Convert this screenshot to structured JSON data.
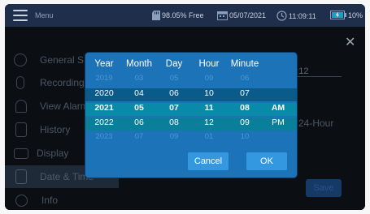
{
  "topbar": {
    "menu_label": "Menu",
    "storage": "98.05% Free",
    "date": "05/07/2021",
    "time": "11:09:11",
    "battery": "10%"
  },
  "sidebar": {
    "items": [
      {
        "label": "General S",
        "icon": "gear-icon"
      },
      {
        "label": "Recording",
        "icon": "microphone-icon"
      },
      {
        "label": "View Alarm",
        "icon": "bell-icon"
      },
      {
        "label": "History",
        "icon": "history-icon"
      },
      {
        "label": "Display",
        "icon": "monitor-icon"
      },
      {
        "label": "Date & Time",
        "icon": "calendar-clock-icon"
      },
      {
        "label": "Info",
        "icon": "info-icon"
      }
    ]
  },
  "background": {
    "time_value": "08:12",
    "format_label": "24-Hour",
    "save_label": "Save"
  },
  "picker": {
    "headers": {
      "year": "Year",
      "month": "Month",
      "day": "Day",
      "hour": "Hour",
      "minute": "Minute"
    },
    "rows": [
      {
        "year": "2019",
        "month": "03",
        "day": "05",
        "hour": "09",
        "minute": "06",
        "ampm": ""
      },
      {
        "year": "2020",
        "month": "04",
        "day": "06",
        "hour": "10",
        "minute": "07",
        "ampm": ""
      },
      {
        "year": "2021",
        "month": "05",
        "day": "07",
        "hour": "11",
        "minute": "08",
        "ampm": "AM"
      },
      {
        "year": "2022",
        "month": "06",
        "day": "08",
        "hour": "12",
        "minute": "09",
        "ampm": "PM"
      },
      {
        "year": "2023",
        "month": "07",
        "day": "09",
        "hour": "01",
        "minute": "10",
        "ampm": ""
      }
    ],
    "cancel_label": "Cancel",
    "ok_label": "OK"
  }
}
